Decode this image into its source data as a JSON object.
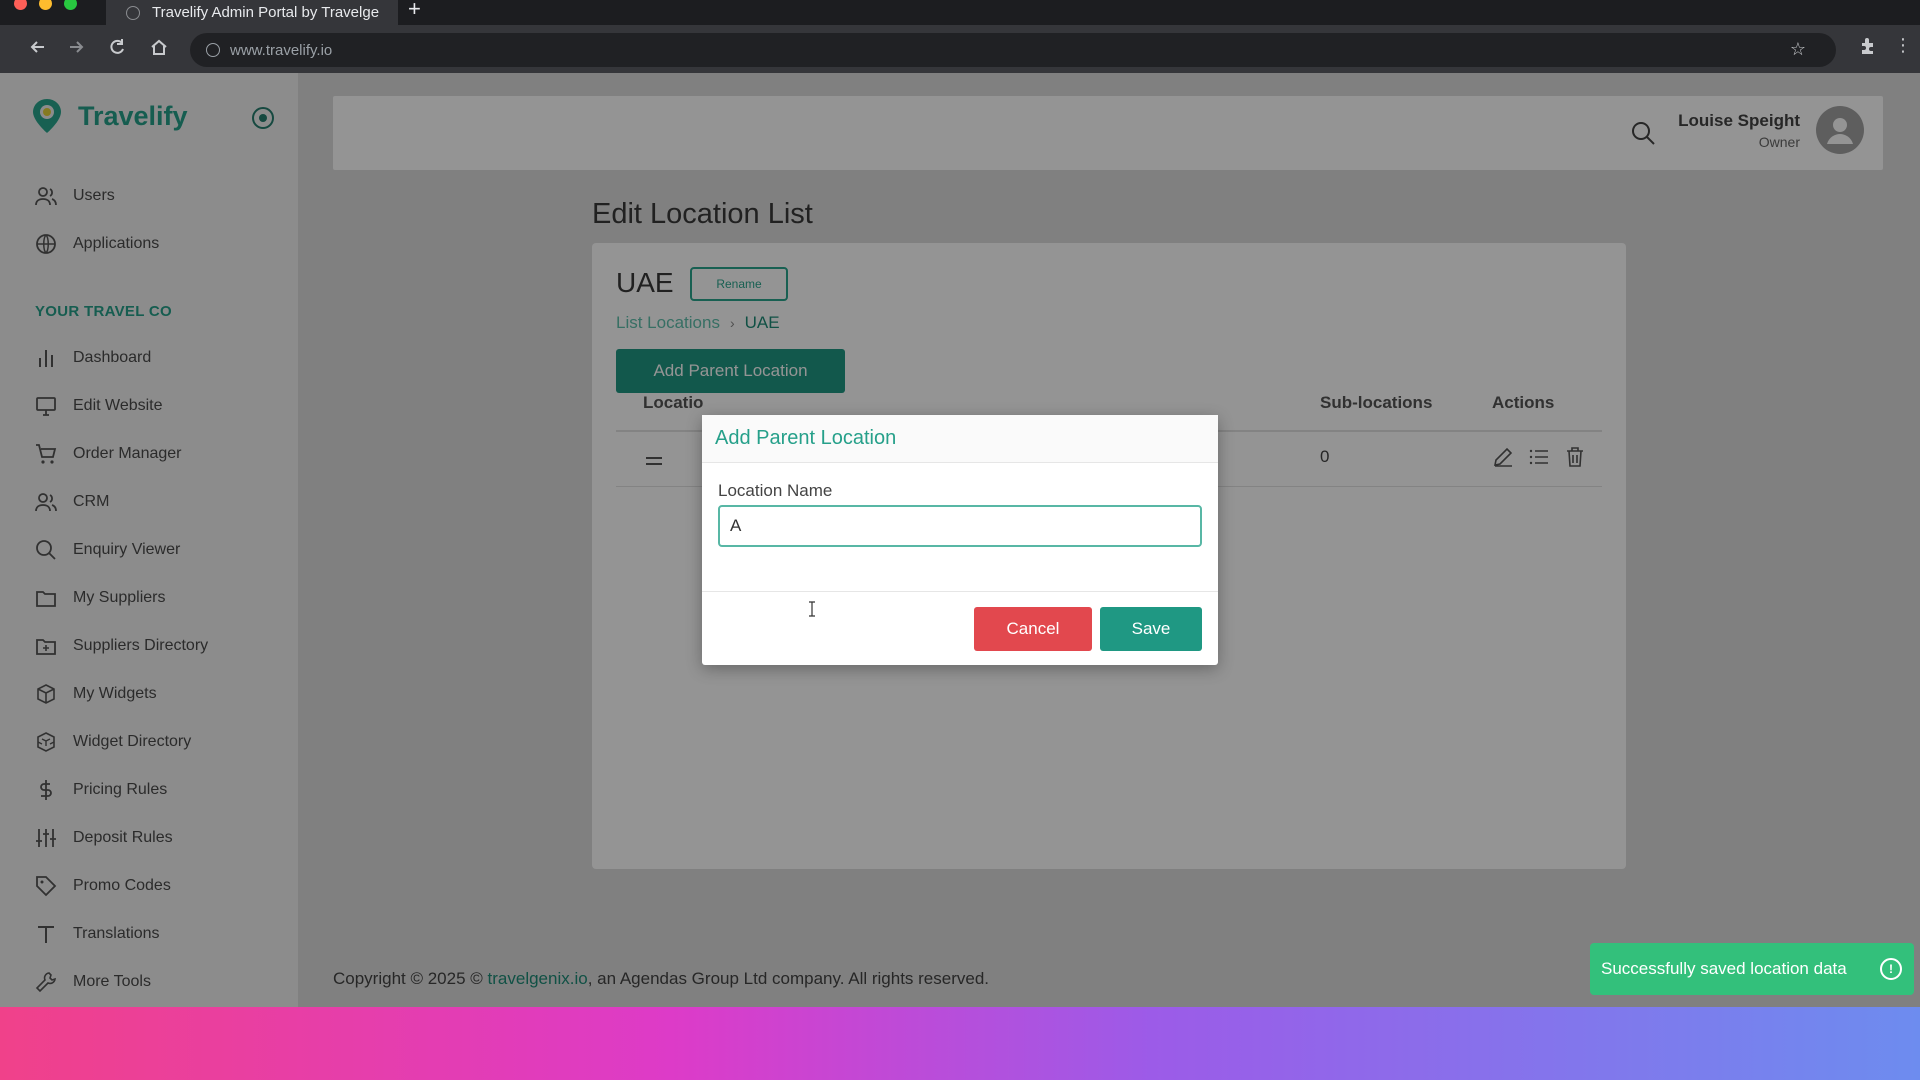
{
  "browser": {
    "tab_title": "Travelify Admin Portal by Travelge",
    "url": "www.travelify.io"
  },
  "brand": {
    "name": "Travelify",
    "accent": "#26a08a"
  },
  "sidebar": {
    "top_items": [
      {
        "label": "Users",
        "icon": "users-icon"
      },
      {
        "label": "Applications",
        "icon": "globe-icon"
      }
    ],
    "section_label": "YOUR TRAVEL CO",
    "items": [
      {
        "label": "Dashboard",
        "icon": "bar-chart-icon"
      },
      {
        "label": "Edit Website",
        "icon": "monitor-icon"
      },
      {
        "label": "Order Manager",
        "icon": "cart-icon"
      },
      {
        "label": "CRM",
        "icon": "users-icon"
      },
      {
        "label": "Enquiry Viewer",
        "icon": "search-icon"
      },
      {
        "label": "My Suppliers",
        "icon": "folder-icon"
      },
      {
        "label": "Suppliers Directory",
        "icon": "folder-plus-icon"
      },
      {
        "label": "My Widgets",
        "icon": "cube-icon"
      },
      {
        "label": "Widget Directory",
        "icon": "cubes-icon"
      },
      {
        "label": "Pricing Rules",
        "icon": "dollar-icon"
      },
      {
        "label": "Deposit Rules",
        "icon": "sliders-icon"
      },
      {
        "label": "Promo Codes",
        "icon": "tag-icon"
      },
      {
        "label": "Translations",
        "icon": "text-icon"
      },
      {
        "label": "More Tools",
        "icon": "wrench-icon"
      }
    ]
  },
  "header": {
    "user_name": "Louise Speight",
    "user_role": "Owner"
  },
  "main": {
    "page_title": "Edit Location List",
    "card_heading": "UAE",
    "rename_label": "Rename",
    "breadcrumb": {
      "link": "List Locations",
      "current": "UAE"
    },
    "add_parent_label": "Add Parent Location",
    "table": {
      "headers": [
        "Locatio",
        "Sub-locations",
        "Actions"
      ],
      "rows": [
        {
          "sub_locations": "0"
        }
      ]
    }
  },
  "modal": {
    "title": "Add Parent Location",
    "field_label": "Location Name",
    "field_value": "A",
    "cancel_label": "Cancel",
    "save_label": "Save"
  },
  "footer": {
    "prefix": "Copyright © 2025 © ",
    "link": "travelgenix.io",
    "suffix": ", an Agendas Group Ltd company. All rights reserved."
  },
  "toast": {
    "message": "Successfully saved location data",
    "color": "#33c07b"
  }
}
